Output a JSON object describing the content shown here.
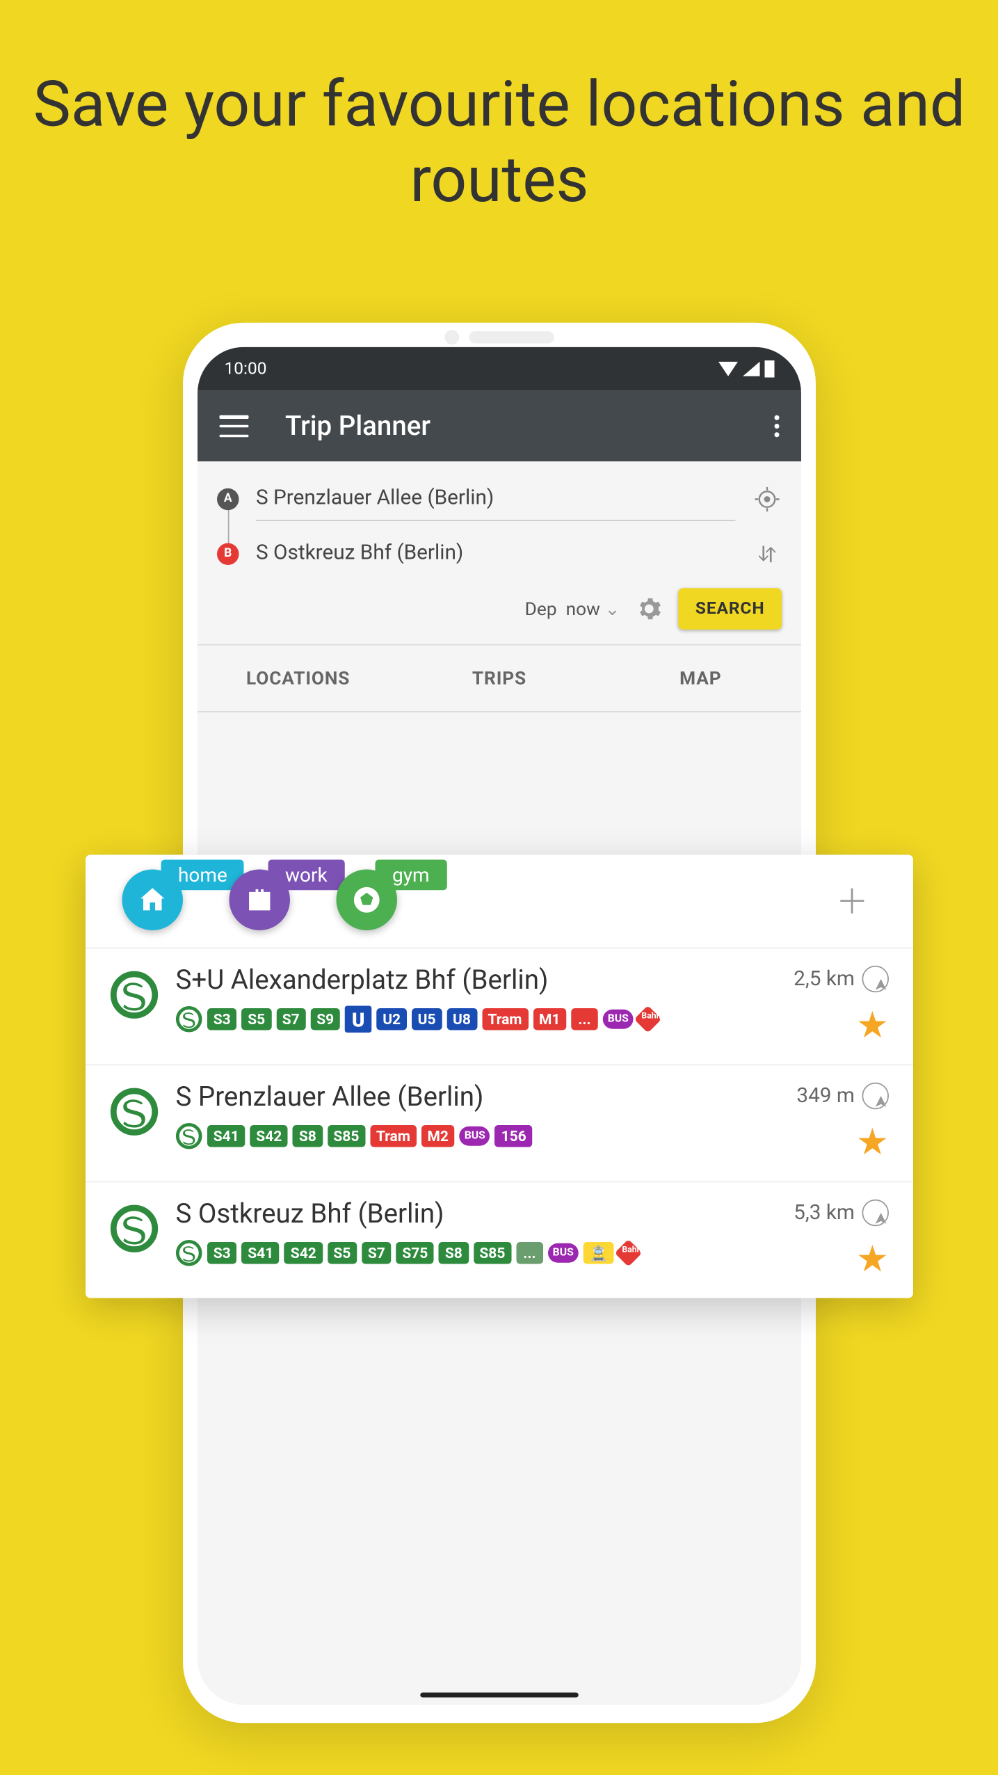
{
  "headline": "Save your favourite locations and routes",
  "statusbar": {
    "time": "10:00"
  },
  "appbar": {
    "title": "Trip Planner"
  },
  "search": {
    "from": "S Prenzlauer Allee (Berlin)",
    "to": "S Ostkreuz Bhf (Berlin)",
    "dep_label": "Dep",
    "time_label": "now",
    "button": "SEARCH"
  },
  "tabs": [
    "LOCATIONS",
    "TRIPS",
    "MAP"
  ],
  "shortcuts": [
    {
      "label": "home",
      "color_bg": "#1fb5d8",
      "icon": "home"
    },
    {
      "label": "work",
      "color_bg": "#7c52b4",
      "icon": "briefcase"
    },
    {
      "label": "gym",
      "color_bg": "#4caf50",
      "icon": "ball"
    }
  ],
  "stations": [
    {
      "name": "S+U Alexanderplatz Bhf (Berlin)",
      "distance": "2,5 km",
      "lines": [
        {
          "t": "slogo"
        },
        {
          "t": "S3",
          "c": "#2e8b3d"
        },
        {
          "t": "S5",
          "c": "#2e8b3d"
        },
        {
          "t": "S7",
          "c": "#2e8b3d"
        },
        {
          "t": "S9",
          "c": "#2e8b3d"
        },
        {
          "t": "ulogo"
        },
        {
          "t": "U2",
          "c": "#1a4db3"
        },
        {
          "t": "U5",
          "c": "#1a4db3"
        },
        {
          "t": "U8",
          "c": "#1a4db3"
        },
        {
          "t": "Tram",
          "c": "#e53935"
        },
        {
          "t": "M1",
          "c": "#e53935"
        },
        {
          "t": "...",
          "c": "#e53935"
        },
        {
          "t": "BUS",
          "c": "#9c27b0",
          "round": true
        },
        {
          "t": "Bahn",
          "c": "#e53935",
          "diamond": true
        }
      ]
    },
    {
      "name": "S Prenzlauer Allee (Berlin)",
      "distance": "349 m",
      "lines": [
        {
          "t": "slogo"
        },
        {
          "t": "S41",
          "c": "#2e8b3d"
        },
        {
          "t": "S42",
          "c": "#2e8b3d"
        },
        {
          "t": "S8",
          "c": "#2e8b3d"
        },
        {
          "t": "S85",
          "c": "#2e8b3d"
        },
        {
          "t": "Tram",
          "c": "#e53935"
        },
        {
          "t": "M2",
          "c": "#e53935"
        },
        {
          "t": "BUS",
          "c": "#9c27b0",
          "round": true
        },
        {
          "t": "156",
          "c": "#9c27b0"
        }
      ]
    },
    {
      "name": "S Ostkreuz Bhf (Berlin)",
      "distance": "5,3 km",
      "lines": [
        {
          "t": "slogo"
        },
        {
          "t": "S3",
          "c": "#2e8b3d"
        },
        {
          "t": "S41",
          "c": "#2e8b3d"
        },
        {
          "t": "S42",
          "c": "#2e8b3d"
        },
        {
          "t": "S5",
          "c": "#2e8b3d"
        },
        {
          "t": "S7",
          "c": "#2e8b3d"
        },
        {
          "t": "S75",
          "c": "#2e8b3d"
        },
        {
          "t": "S8",
          "c": "#2e8b3d"
        },
        {
          "t": "S85",
          "c": "#2e8b3d"
        },
        {
          "t": "...",
          "c": "#6a9e6f"
        },
        {
          "t": "BUS",
          "c": "#9c27b0",
          "round": true
        },
        {
          "t": "🚊",
          "c": "#fdd835",
          "text": "#333"
        },
        {
          "t": "Bahn",
          "c": "#e53935",
          "diamond": true
        }
      ]
    }
  ]
}
